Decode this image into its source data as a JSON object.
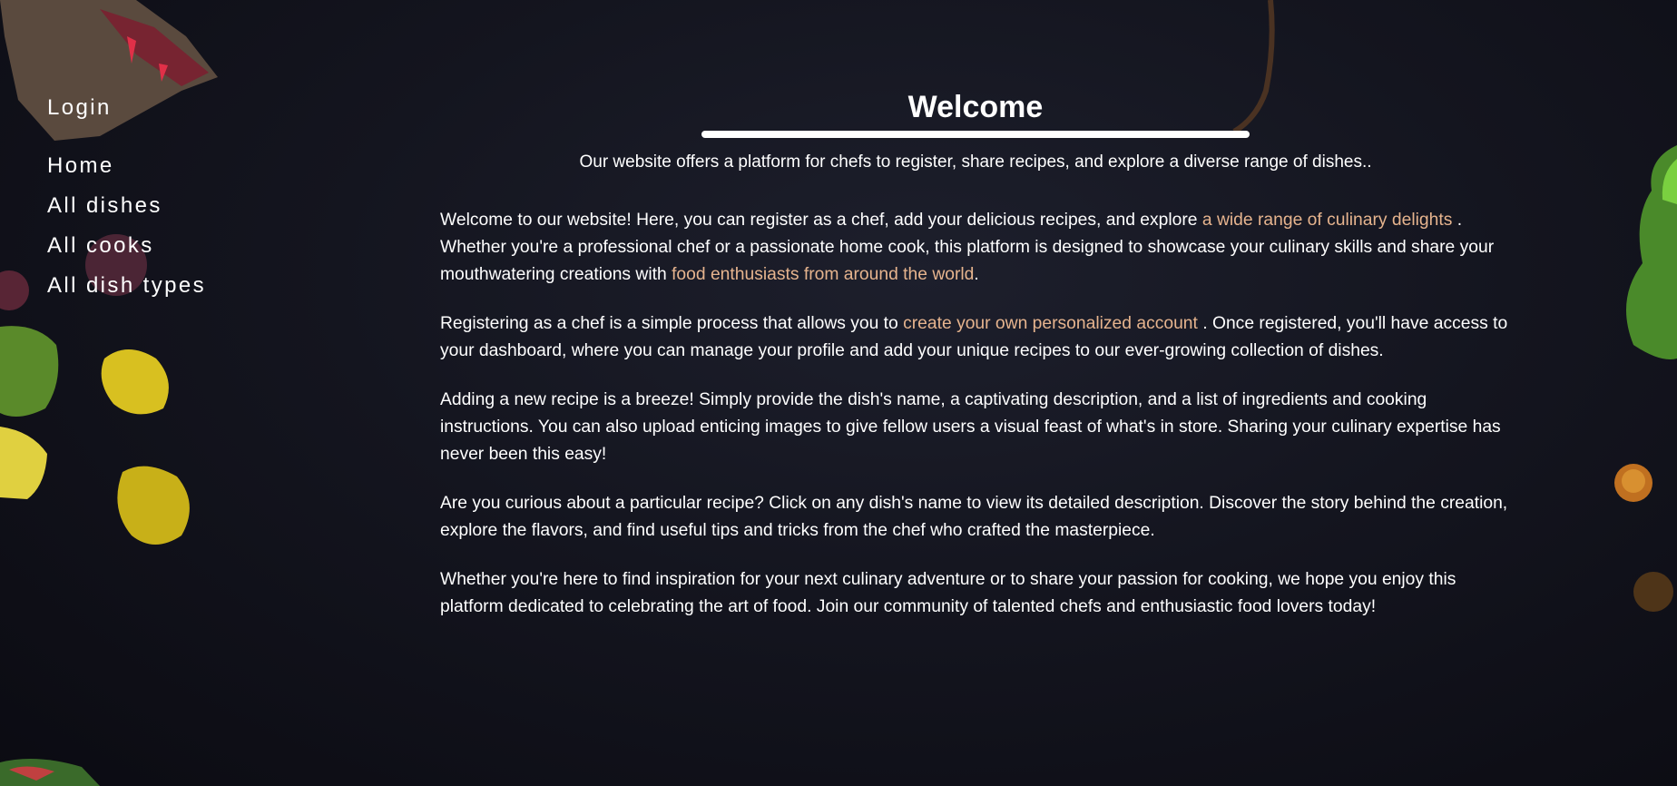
{
  "nav": {
    "login": "Login",
    "home": "Home",
    "all_dishes": "All dishes",
    "all_cooks": "All cooks",
    "all_dish_types": "All dish types"
  },
  "header": {
    "title": "Welcome",
    "subtitle": "Our website offers a platform for chefs to register, share recipes, and explore a diverse range of dishes.."
  },
  "content": {
    "p1_a": "Welcome to our website! Here, you can register as a chef, add your delicious recipes, and explore ",
    "p1_link1": "a wide range of culinary delights",
    "p1_b": " . Whether you're a professional chef or a passionate home cook, this platform is designed to showcase your culinary skills and share your mouthwatering creations with ",
    "p1_link2": "food enthusiasts from around the world",
    "p1_c": ".",
    "p2_a": "Registering as a chef is a simple process that allows you to ",
    "p2_link": "create your own personalized account",
    "p2_b": " . Once registered, you'll have access to your dashboard, where you can manage your profile and add your unique recipes to our ever-growing collection of dishes.",
    "p3": "Adding a new recipe is a breeze! Simply provide the dish's name, a captivating description, and a list of ingredients and cooking instructions. You can also upload enticing images to give fellow users a visual feast of what's in store. Sharing your culinary expertise has never been this easy!",
    "p4": "Are you curious about a particular recipe? Click on any dish's name to view its detailed description. Discover the story behind the creation, explore the flavors, and find useful tips and tricks from the chef who crafted the masterpiece.",
    "p5": "Whether you're here to find inspiration for your next culinary adventure or to share your passion for cooking, we hope you enjoy this platform dedicated to celebrating the art of food. Join our community of talented chefs and enthusiastic food lovers today!"
  },
  "colors": {
    "background": "#14151f",
    "text": "#ffffff",
    "highlight": "#e6b48e"
  }
}
